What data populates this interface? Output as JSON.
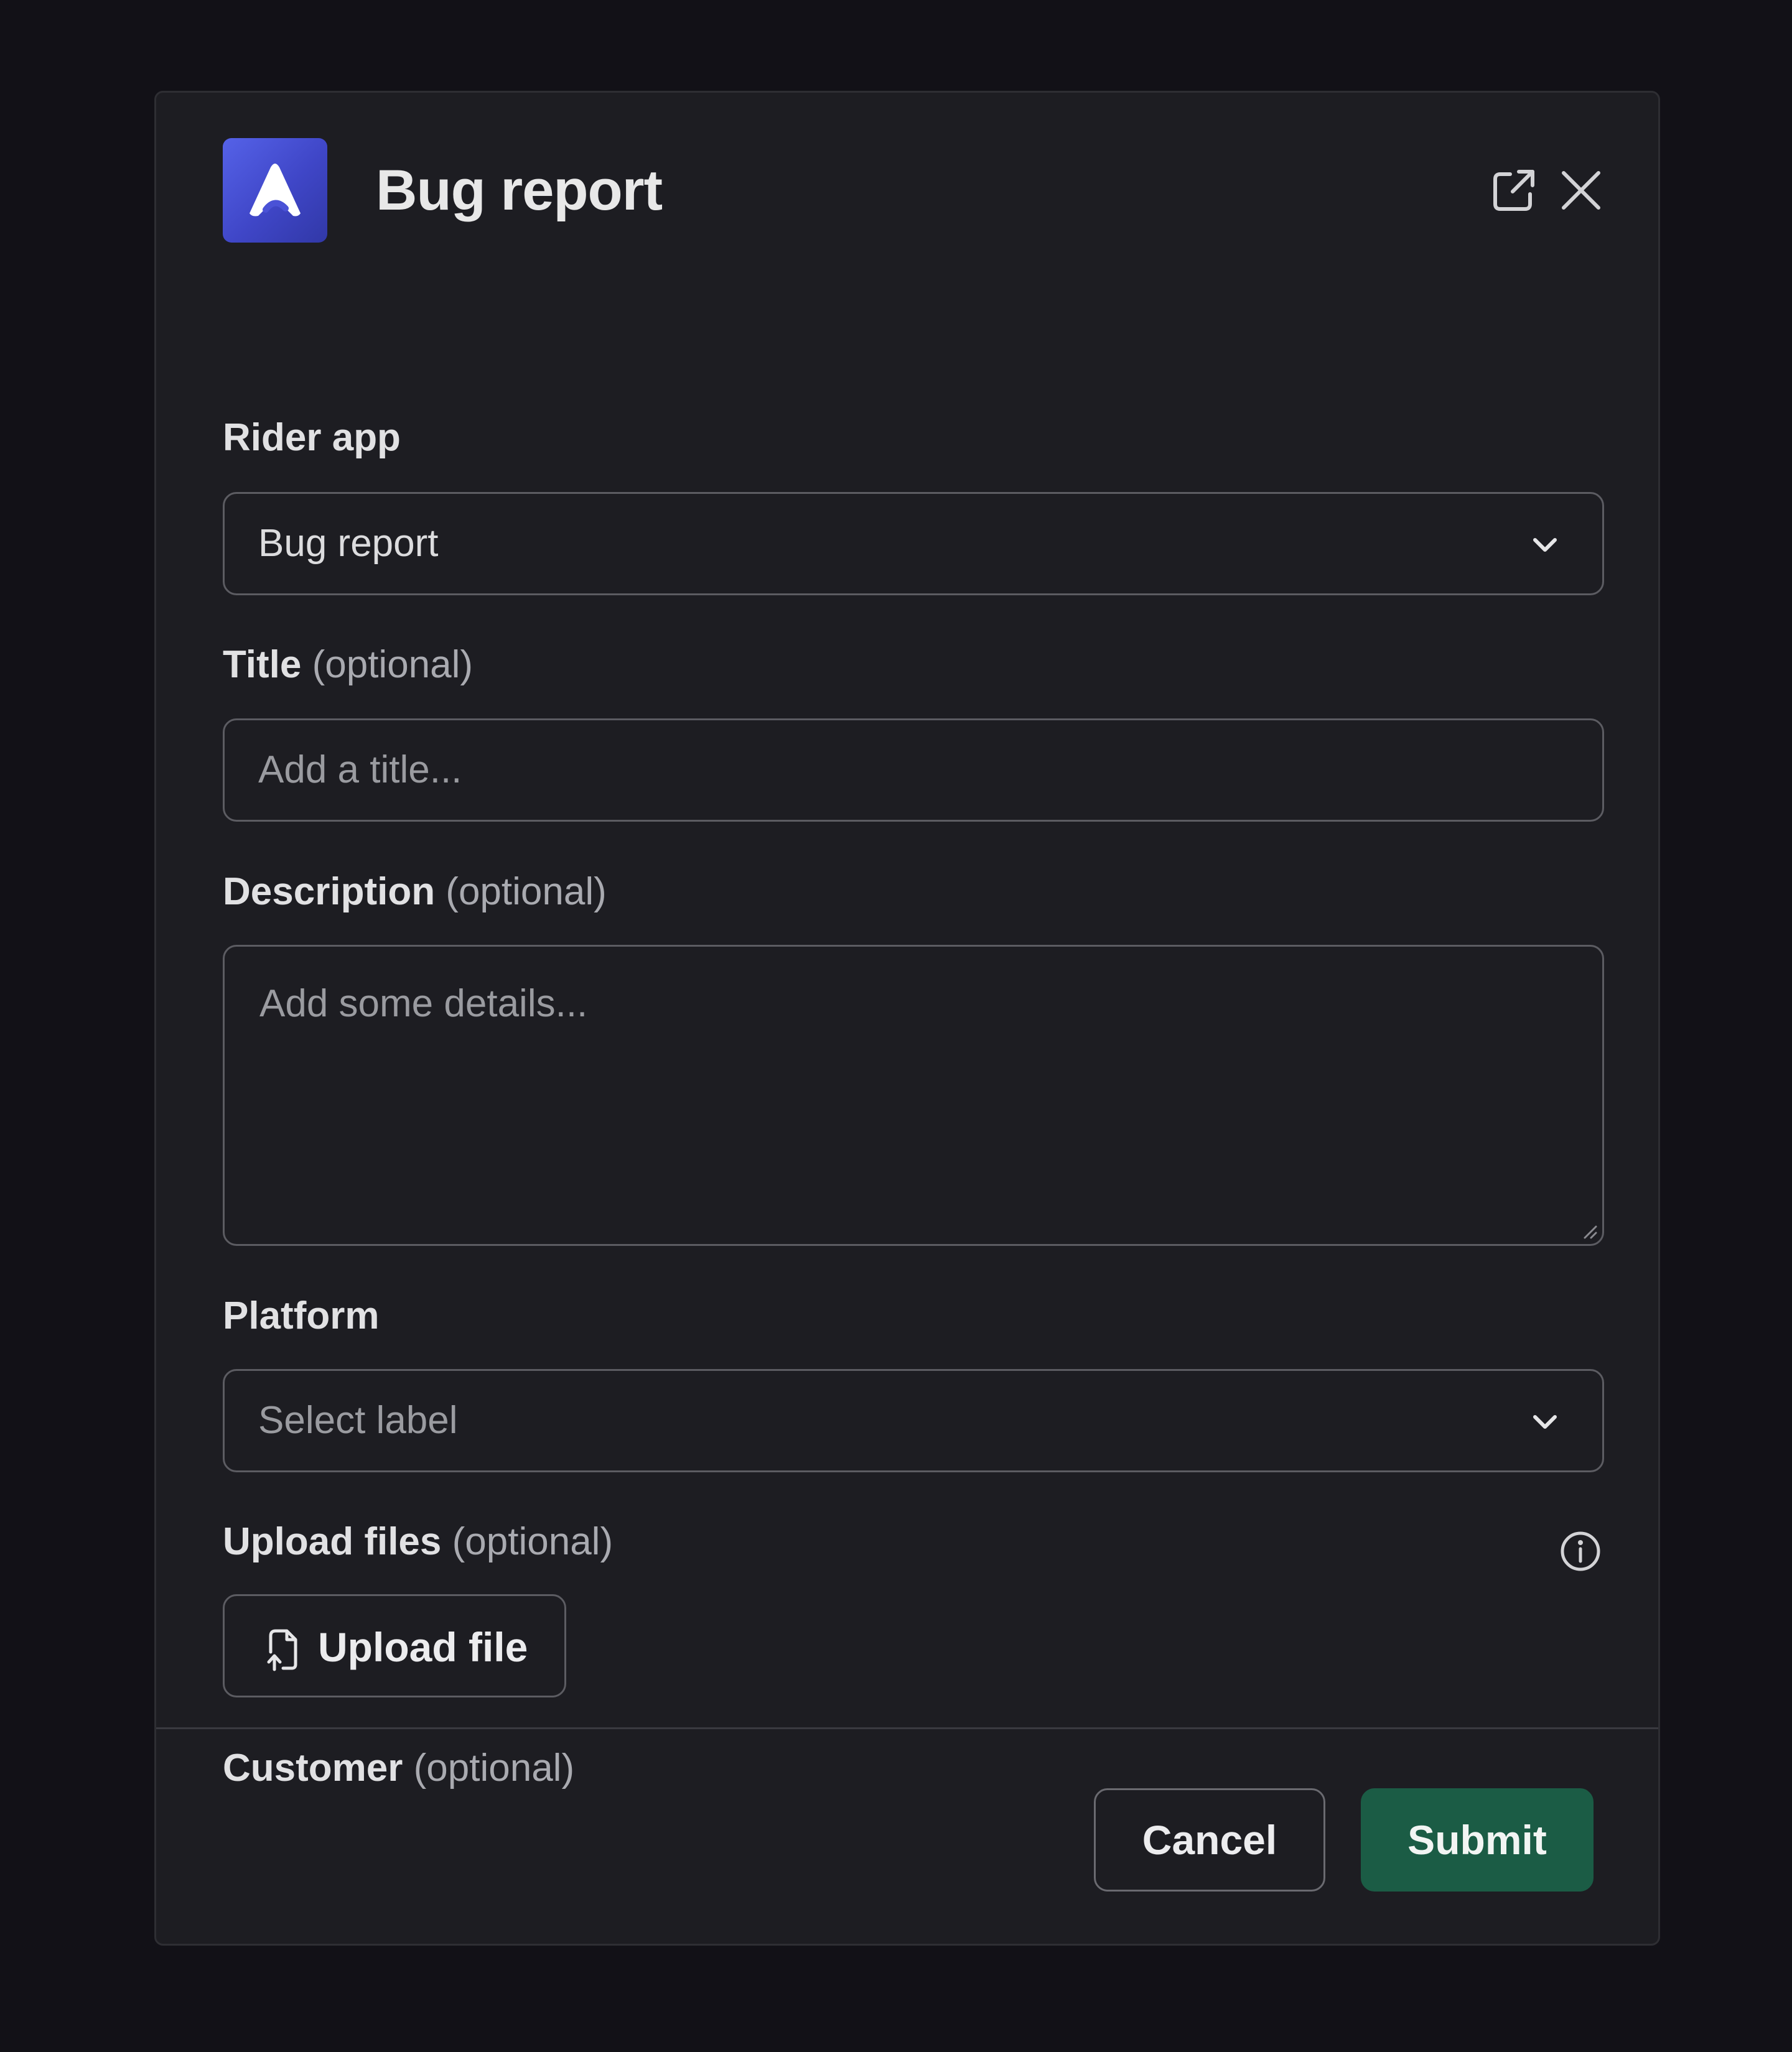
{
  "modal": {
    "title": "Bug report",
    "app_logo_icon": "linear-logo-icon",
    "popout_icon": "open-external-icon",
    "close_icon": "close-icon"
  },
  "fields": {
    "team": {
      "label": "Rider app",
      "value": "Bug report"
    },
    "title": {
      "label": "Title",
      "optional": "(optional)",
      "placeholder": "Add a title..."
    },
    "description": {
      "label": "Description",
      "optional": "(optional)",
      "placeholder": "Add some details..."
    },
    "platform": {
      "label": "Platform",
      "placeholder": "Select label"
    },
    "upload": {
      "label": "Upload files",
      "optional": "(optional)",
      "button_label": "Upload file",
      "info_icon": "info-icon"
    },
    "customer": {
      "label": "Customer",
      "optional": "(optional)"
    }
  },
  "footer": {
    "cancel_label": "Cancel",
    "submit_label": "Submit"
  },
  "colors": {
    "background": "#121117",
    "modal": "#1d1d22",
    "border": "#5c5c62",
    "submit": "#1b5c45",
    "logo": "#4a52d6"
  }
}
